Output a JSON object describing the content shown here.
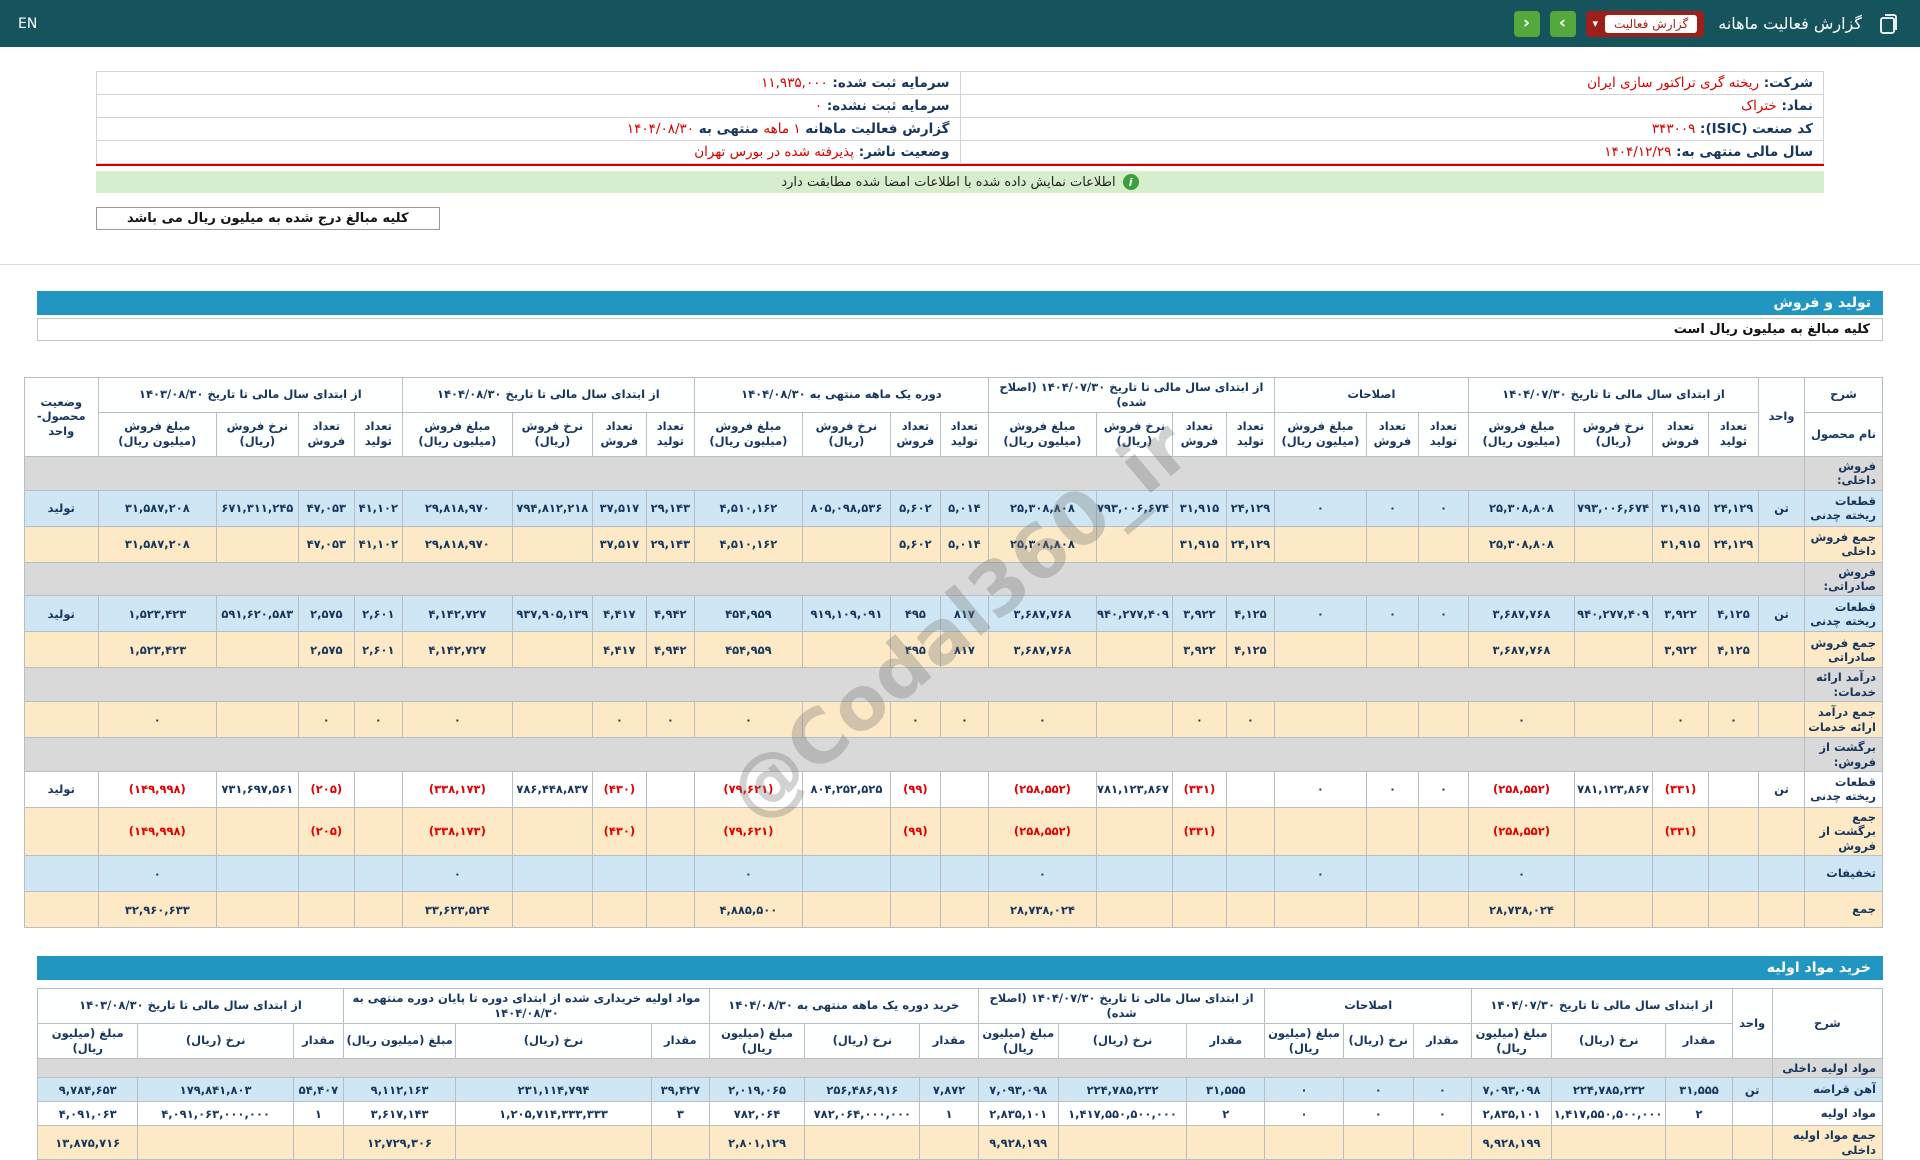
{
  "topbar": {
    "en_label": "EN",
    "title": "گزارش فعالیت ماهانه",
    "dropdown_label": "گزارش فعالیت",
    "nav_next_glyph": "›",
    "nav_prev_glyph": "‹"
  },
  "company_info": {
    "rows": [
      {
        "right": [
          {
            "text": "شرکت: ",
            "b": true
          },
          {
            "text": "ریخته گری تراکتور سازی ایران",
            "red": true
          }
        ],
        "left": [
          {
            "text": "سرمایه ثبت شده: ",
            "b": true
          },
          {
            "text": "۱۱,۹۳۵,۰۰۰",
            "red": true
          }
        ]
      },
      {
        "right": [
          {
            "text": "نماد: ",
            "b": true
          },
          {
            "text": "ختراک",
            "red": true
          }
        ],
        "left": [
          {
            "text": "سرمایه ثبت نشده: ",
            "b": true
          },
          {
            "text": "۰",
            "red": true
          }
        ]
      },
      {
        "right": [
          {
            "text": "کد صنعت (ISIC): ",
            "b": true
          },
          {
            "text": "۳۴۳۰۰۹",
            "red": true
          }
        ],
        "left": [
          {
            "text": "گزارش فعالیت ماهانه ",
            "b": true
          },
          {
            "text": "۱ ماهه",
            "red": true
          },
          {
            "text": " منتهی به ",
            "b": true
          },
          {
            "text": "۱۴۰۴/۰۸/۳۰",
            "red": true
          }
        ]
      },
      {
        "right": [
          {
            "text": "سال مالی منتهی به: ",
            "b": true
          },
          {
            "text": "۱۴۰۴/۱۲/۲۹",
            "red": true
          }
        ],
        "left": [
          {
            "text": "وضعیت ناشر: ",
            "b": true
          },
          {
            "text": "پذیرفته شده در بورس تهران",
            "red": true
          }
        ]
      }
    ]
  },
  "signed_note": "اطلاعات نمایش داده شده با اطلاعات امضا شده مطابقت دارد",
  "amounts_note": "کلیه مبالغ درج شده به میلیون ریال می باشد",
  "production_section_title": "تولید و فروش",
  "production_subtitle": "کلیه مبالغ به میلیون ریال است",
  "materials_section_title": "خرید مواد اولیه",
  "watermark": "@Codal360_ir",
  "production_table": {
    "corner": {
      "desc": "شرح",
      "product_name": "نام محصول",
      "unit": "واحد",
      "status": "وضعیت محصول-واحد"
    },
    "groups": {
      "g1": "از ابتدای سال مالی تا تاریخ ۱۴۰۴/۰۷/۳۰",
      "adjust": "اصلاحات",
      "g2": "از ابتدای سال مالی تا تاریخ ۱۴۰۴/۰۷/۳۰ (اصلاح شده)",
      "g3": "دوره یک ماهه منتهی به ۱۴۰۴/۰۸/۳۰",
      "g4": "از ابتدای سال مالی تا تاریخ ۱۴۰۴/۰۸/۳۰",
      "g5": "از ابتدای سال مالی تا تاریخ ۱۴۰۳/۰۸/۳۰"
    },
    "subs": {
      "qty_prod": "تعداد تولید",
      "qty_sale": "تعداد فروش",
      "rate": "نرخ فروش (ریال)",
      "amount": "مبلغ فروش (میلیون ریال)"
    },
    "rows": [
      {
        "type": "section",
        "label": "فروش داخلی:"
      },
      {
        "type": "product",
        "cells": [
          "قطعات ریخته چدنی",
          "تن",
          "۲۴,۱۲۹",
          "۳۱,۹۱۵",
          "۷۹۳,۰۰۶,۶۷۴",
          "۲۵,۳۰۸,۸۰۸",
          "۰",
          "۰",
          "۰",
          "۲۴,۱۲۹",
          "۳۱,۹۱۵",
          "۷۹۳,۰۰۶,۶۷۴",
          "۲۵,۳۰۸,۸۰۸",
          "۵,۰۱۴",
          "۵,۶۰۲",
          "۸۰۵,۰۹۸,۵۳۶",
          "۴,۵۱۰,۱۶۲",
          "۲۹,۱۴۳",
          "۳۷,۵۱۷",
          "۷۹۴,۸۱۲,۲۱۸",
          "۲۹,۸۱۸,۹۷۰",
          "۴۱,۱۰۲",
          "۴۷,۰۵۳",
          "۶۷۱,۳۱۱,۲۴۵",
          "۳۱,۵۸۷,۲۰۸",
          "تولید"
        ]
      },
      {
        "type": "sum",
        "cells": [
          "جمع فروش داخلی",
          "",
          "۲۴,۱۲۹",
          "۳۱,۹۱۵",
          "",
          "۲۵,۳۰۸,۸۰۸",
          "",
          "",
          "",
          "۲۴,۱۲۹",
          "۳۱,۹۱۵",
          "",
          "۲۵,۳۰۸,۸۰۸",
          "۵,۰۱۴",
          "۵,۶۰۲",
          "",
          "۴,۵۱۰,۱۶۲",
          "۲۹,۱۴۳",
          "۳۷,۵۱۷",
          "",
          "۲۹,۸۱۸,۹۷۰",
          "۴۱,۱۰۲",
          "۴۷,۰۵۳",
          "",
          "۳۱,۵۸۷,۲۰۸",
          ""
        ]
      },
      {
        "type": "section",
        "label": "فروش صادراتی:"
      },
      {
        "type": "product",
        "cells": [
          "قطعات ریخته چدنی",
          "تن",
          "۴,۱۲۵",
          "۳,۹۲۲",
          "۹۴۰,۲۷۷,۴۰۹",
          "۳,۶۸۷,۷۶۸",
          "۰",
          "۰",
          "۰",
          "۴,۱۲۵",
          "۳,۹۲۲",
          "۹۴۰,۲۷۷,۴۰۹",
          "۳,۶۸۷,۷۶۸",
          "۸۱۷",
          "۴۹۵",
          "۹۱۹,۱۰۹,۰۹۱",
          "۴۵۴,۹۵۹",
          "۴,۹۴۲",
          "۴,۴۱۷",
          "۹۳۷,۹۰۵,۱۳۹",
          "۴,۱۴۲,۷۲۷",
          "۲,۶۰۱",
          "۲,۵۷۵",
          "۵۹۱,۶۲۰,۵۸۳",
          "۱,۵۲۳,۴۲۳",
          "تولید"
        ]
      },
      {
        "type": "sum",
        "cells": [
          "جمع فروش صادراتی",
          "",
          "۴,۱۲۵",
          "۳,۹۲۲",
          "",
          "۳,۶۸۷,۷۶۸",
          "",
          "",
          "",
          "۴,۱۲۵",
          "۳,۹۲۲",
          "",
          "۳,۶۸۷,۷۶۸",
          "۸۱۷",
          "۴۹۵",
          "",
          "۴۵۴,۹۵۹",
          "۴,۹۴۲",
          "۴,۴۱۷",
          "",
          "۴,۱۴۲,۷۲۷",
          "۲,۶۰۱",
          "۲,۵۷۵",
          "",
          "۱,۵۲۳,۴۲۳",
          ""
        ]
      },
      {
        "type": "section",
        "label": "درآمد ارائه خدمات:"
      },
      {
        "type": "sum",
        "cells": [
          "جمع درآمد ارائه خدمات",
          "",
          "۰",
          "۰",
          "",
          "۰",
          "",
          "",
          "",
          "۰",
          "۰",
          "",
          "۰",
          "۰",
          "۰",
          "",
          "۰",
          "۰",
          "۰",
          "",
          "۰",
          "۰",
          "۰",
          "",
          "۰",
          ""
        ]
      },
      {
        "type": "section",
        "label": "برگشت از فروش:"
      },
      {
        "type": "product-light",
        "cells": [
          "قطعات ریخته چدنی",
          "تن",
          "",
          "(۳۳۱)",
          "۷۸۱,۱۲۳,۸۶۷",
          "(۲۵۸,۵۵۲)",
          "۰",
          "۰",
          "۰",
          "",
          "(۳۳۱)",
          "۷۸۱,۱۲۳,۸۶۷",
          "(۲۵۸,۵۵۲)",
          "",
          "(۹۹)",
          "۸۰۴,۲۵۲,۵۲۵",
          "(۷۹,۶۲۱)",
          "",
          "(۴۳۰)",
          "۷۸۶,۴۴۸,۸۳۷",
          "(۳۳۸,۱۷۳)",
          "",
          "(۲۰۵)",
          "۷۳۱,۶۹۷,۵۶۱",
          "(۱۴۹,۹۹۸)",
          "تولید"
        ]
      },
      {
        "type": "sum",
        "cells": [
          "جمع برگشت از فروش",
          "",
          "",
          "(۳۳۱)",
          "",
          "(۲۵۸,۵۵۲)",
          "",
          "",
          "",
          "",
          "(۳۳۱)",
          "",
          "(۲۵۸,۵۵۲)",
          "",
          "(۹۹)",
          "",
          "(۷۹,۶۲۱)",
          "",
          "(۴۳۰)",
          "",
          "(۳۳۸,۱۷۳)",
          "",
          "(۲۰۵)",
          "",
          "(۱۴۹,۹۹۸)",
          ""
        ]
      },
      {
        "type": "product",
        "cells": [
          "تخفیفات",
          "",
          "",
          "",
          "",
          "۰",
          "",
          "",
          "۰",
          "",
          "",
          "",
          "۰",
          "",
          "",
          "",
          "۰",
          "",
          "",
          "",
          "۰",
          "",
          "",
          "",
          "۰",
          ""
        ]
      },
      {
        "type": "sum",
        "cells": [
          "جمع",
          "",
          "",
          "",
          "",
          "۲۸,۷۳۸,۰۲۴",
          "",
          "",
          "",
          "",
          "",
          "",
          "۲۸,۷۳۸,۰۲۴",
          "",
          "",
          "",
          "۴,۸۸۵,۵۰۰",
          "",
          "",
          "",
          "۳۳,۶۲۳,۵۲۴",
          "",
          "",
          "",
          "۳۲,۹۶۰,۶۳۳",
          ""
        ]
      }
    ]
  },
  "materials_table": {
    "corner": {
      "desc": "شرح",
      "unit": "واحد"
    },
    "groups": {
      "g1": "از ابتدای سال مالی تا تاریخ ۱۴۰۴/۰۷/۳۰",
      "adjust": "اصلاحات",
      "g2": "از ابتدای سال مالی تا تاریخ ۱۴۰۴/۰۷/۳۰ (اصلاح شده)",
      "g3": "خرید دوره یک ماهه منتهی به ۱۴۰۴/۰۸/۳۰",
      "g4": "مواد اولیه خریداری شده از ابتدای دوره تا پایان دوره منتهی به ۱۴۰۴/۰۸/۳۰",
      "g5": "از ابتدای سال مالی تا تاریخ ۱۴۰۳/۰۸/۳۰"
    },
    "subs": {
      "qty": "مقدار",
      "rate": "نرخ (ریال)",
      "amount": "مبلغ (میلیون ریال)"
    },
    "rows": [
      {
        "type": "section",
        "label": "مواد اولیه داخلی"
      },
      {
        "type": "product",
        "cells": [
          "آهن قراضه",
          "تن",
          "۳۱,۵۵۵",
          "۲۲۴,۷۸۵,۲۳۲",
          "۷,۰۹۳,۰۹۸",
          "۰",
          "۰",
          "۰",
          "۳۱,۵۵۵",
          "۲۲۴,۷۸۵,۲۳۲",
          "۷,۰۹۳,۰۹۸",
          "۷,۸۷۲",
          "۲۵۶,۴۸۶,۹۱۶",
          "۲,۰۱۹,۰۶۵",
          "۳۹,۴۲۷",
          "۲۳۱,۱۱۴,۷۹۴",
          "۹,۱۱۲,۱۶۳",
          "۵۴,۴۰۷",
          "۱۷۹,۸۴۱,۸۰۳",
          "۹,۷۸۴,۶۵۳"
        ]
      },
      {
        "type": "product-light",
        "cells": [
          "مواد اولیه",
          "",
          "۲",
          "۱,۴۱۷,۵۵۰,۵۰۰,۰۰۰",
          "۲,۸۳۵,۱۰۱",
          "۰",
          "۰",
          "۰",
          "۲",
          "۱,۴۱۷,۵۵۰,۵۰۰,۰۰۰",
          "۲,۸۳۵,۱۰۱",
          "۱",
          "۷۸۲,۰۶۴,۰۰۰,۰۰۰",
          "۷۸۲,۰۶۴",
          "۳",
          "۱,۲۰۵,۷۱۴,۳۳۳,۳۳۳",
          "۳,۶۱۷,۱۴۳",
          "۱",
          "۴,۰۹۱,۰۶۳,۰۰۰,۰۰۰",
          "۴,۰۹۱,۰۶۳"
        ]
      },
      {
        "type": "sum",
        "cells": [
          "جمع مواد اولیه داخلی",
          "",
          "",
          "",
          "۹,۹۲۸,۱۹۹",
          "",
          "",
          "",
          "",
          "",
          "۹,۹۲۸,۱۹۹",
          "",
          "",
          "۲,۸۰۱,۱۲۹",
          "",
          "",
          "۱۲,۷۲۹,۳۰۶",
          "",
          "",
          "۱۳,۸۷۵,۷۱۶"
        ]
      }
    ]
  }
}
